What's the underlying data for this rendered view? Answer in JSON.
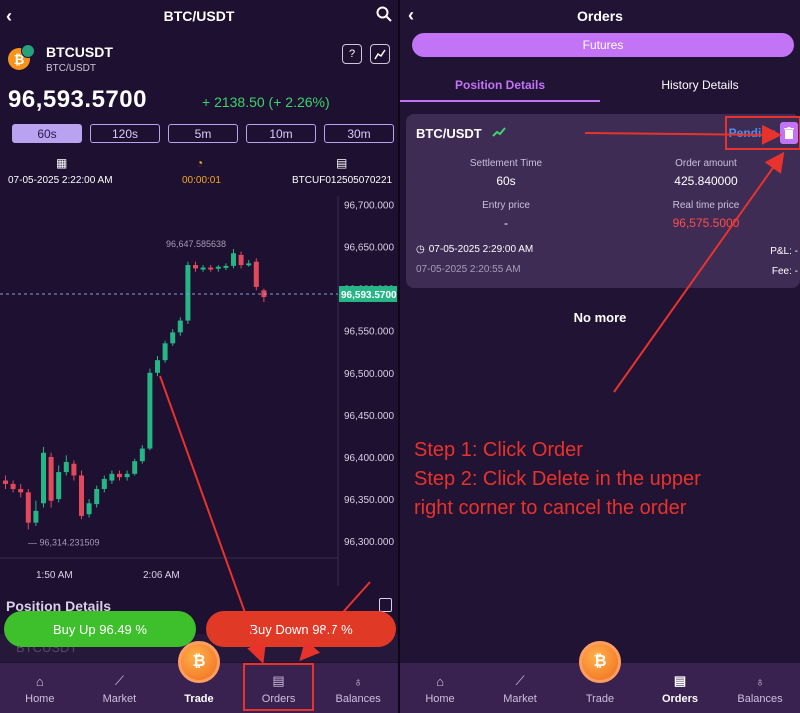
{
  "left": {
    "title": "BTC/USDT",
    "coin_symbol": "BTCUSDT",
    "coin_pair": "BTC/USDT",
    "coin_logo_letter": "₿",
    "help_label": "?",
    "price": "96,593.5700",
    "change": "+ 2138.50 (+ 2.26%)",
    "periods": [
      "60s",
      "120s",
      "5m",
      "10m",
      "30m"
    ],
    "active_period": "60s",
    "info": {
      "date": "07-05-2025 2:22:00 AM",
      "countdown": "00:00:01",
      "order_no": "BTCUF012505070221"
    },
    "position_title": "Position Details",
    "ghost_row": "BTCUSDT",
    "buy_up": "Buy Up 96.49 %",
    "buy_down": "Buy Down 98.7 %"
  },
  "chart_data": {
    "type": "candlestick",
    "y_ticks": [
      "96,700.000",
      "96,650.000",
      "96,600.000",
      "96,550.000",
      "96,500.000",
      "96,450.000",
      "96,400.000",
      "96,350.000",
      "96,300.000"
    ],
    "x_ticks": [
      "1:50 AM",
      "2:06 AM"
    ],
    "ylim": [
      96280,
      96710
    ],
    "high_label": "96,647.585638",
    "low_label": "96,314.231509",
    "current_price_label": "96,593.5700",
    "current_price": 96593.57,
    "candles": [
      {
        "o": 96372,
        "c": 96368,
        "h": 96378,
        "l": 96362
      },
      {
        "o": 96368,
        "c": 96362,
        "h": 96372,
        "l": 96358
      },
      {
        "o": 96362,
        "c": 96358,
        "h": 96368,
        "l": 96352
      },
      {
        "o": 96358,
        "c": 96322,
        "h": 96362,
        "l": 96314
      },
      {
        "o": 96322,
        "c": 96336,
        "h": 96348,
        "l": 96318
      },
      {
        "o": 96345,
        "c": 96405,
        "h": 96412,
        "l": 96340
      },
      {
        "o": 96400,
        "c": 96348,
        "h": 96405,
        "l": 96340
      },
      {
        "o": 96350,
        "c": 96382,
        "h": 96390,
        "l": 96346
      },
      {
        "o": 96382,
        "c": 96394,
        "h": 96402,
        "l": 96378
      },
      {
        "o": 96392,
        "c": 96378,
        "h": 96396,
        "l": 96372
      },
      {
        "o": 96378,
        "c": 96330,
        "h": 96384,
        "l": 96326
      },
      {
        "o": 96332,
        "c": 96345,
        "h": 96350,
        "l": 96328
      },
      {
        "o": 96344,
        "c": 96362,
        "h": 96366,
        "l": 96340
      },
      {
        "o": 96362,
        "c": 96374,
        "h": 96378,
        "l": 96358
      },
      {
        "o": 96372,
        "c": 96380,
        "h": 96384,
        "l": 96368
      },
      {
        "o": 96380,
        "c": 96376,
        "h": 96384,
        "l": 96372
      },
      {
        "o": 96376,
        "c": 96380,
        "h": 96384,
        "l": 96372
      },
      {
        "o": 96380,
        "c": 96395,
        "h": 96398,
        "l": 96378
      },
      {
        "o": 96395,
        "c": 96410,
        "h": 96414,
        "l": 96392
      },
      {
        "o": 96410,
        "c": 96500,
        "h": 96505,
        "l": 96408
      },
      {
        "o": 96500,
        "c": 96515,
        "h": 96520,
        "l": 96496
      },
      {
        "o": 96515,
        "c": 96535,
        "h": 96538,
        "l": 96512
      },
      {
        "o": 96535,
        "c": 96548,
        "h": 96552,
        "l": 96532
      },
      {
        "o": 96548,
        "c": 96562,
        "h": 96566,
        "l": 96544
      },
      {
        "o": 96562,
        "c": 96628,
        "h": 96632,
        "l": 96558
      },
      {
        "o": 96628,
        "c": 96624,
        "h": 96632,
        "l": 96620
      },
      {
        "o": 96624,
        "c": 96625,
        "h": 96628,
        "l": 96620
      },
      {
        "o": 96625,
        "c": 96624,
        "h": 96628,
        "l": 96620
      },
      {
        "o": 96624,
        "c": 96626,
        "h": 96628,
        "l": 96620
      },
      {
        "o": 96626,
        "c": 96627,
        "h": 96630,
        "l": 96622
      },
      {
        "o": 96627,
        "c": 96642,
        "h": 96647,
        "l": 96624
      },
      {
        "o": 96640,
        "c": 96628,
        "h": 96644,
        "l": 96624
      },
      {
        "o": 96628,
        "c": 96630,
        "h": 96634,
        "l": 96626
      },
      {
        "o": 96632,
        "c": 96602,
        "h": 96636,
        "l": 96598
      },
      {
        "o": 96598,
        "c": 96590,
        "h": 96600,
        "l": 96584
      }
    ],
    "colors": {
      "up": "#26b686",
      "down": "#e24a5c"
    }
  },
  "nav": {
    "items": [
      {
        "label": "Home",
        "icon": "home-icon",
        "glyph": "⌂"
      },
      {
        "label": "Market",
        "icon": "market-icon",
        "glyph": "⟋"
      },
      {
        "label": "Trade",
        "icon": "trade-icon",
        "glyph": ""
      },
      {
        "label": "Orders",
        "icon": "orders-icon",
        "glyph": "▤"
      },
      {
        "label": "Balances",
        "icon": "balances-icon",
        "glyph": "♁"
      }
    ],
    "trade_glyph": "₿"
  },
  "right": {
    "title": "Orders",
    "futures": "Futures",
    "tabs": [
      "Position Details",
      "History Details"
    ],
    "card": {
      "pair": "BTC/USDT",
      "status": "Pending",
      "settlement_label": "Settlement Time",
      "settlement_value": "60s",
      "amount_label": "Order amount",
      "amount_value": "425.840000",
      "entry_label": "Entry price",
      "entry_value": "-",
      "real_label": "Real time price",
      "real_value": "96,575.5000",
      "time_open": "07-05-2025 2:29:00 AM",
      "time_created": "07-05-2025 2:20:55 AM",
      "pl_label": "P&L: -",
      "fee_label": "Fee: -"
    },
    "no_more": "No more",
    "steps": [
      "Step 1: Click Order",
      "Step 2: Click Delete in the upper",
      "right corner to cancel the order"
    ]
  },
  "colors": {
    "accent": "#c373f5",
    "up": "#3ec02c",
    "down": "#e03a26",
    "annotation": "#e8332c"
  }
}
